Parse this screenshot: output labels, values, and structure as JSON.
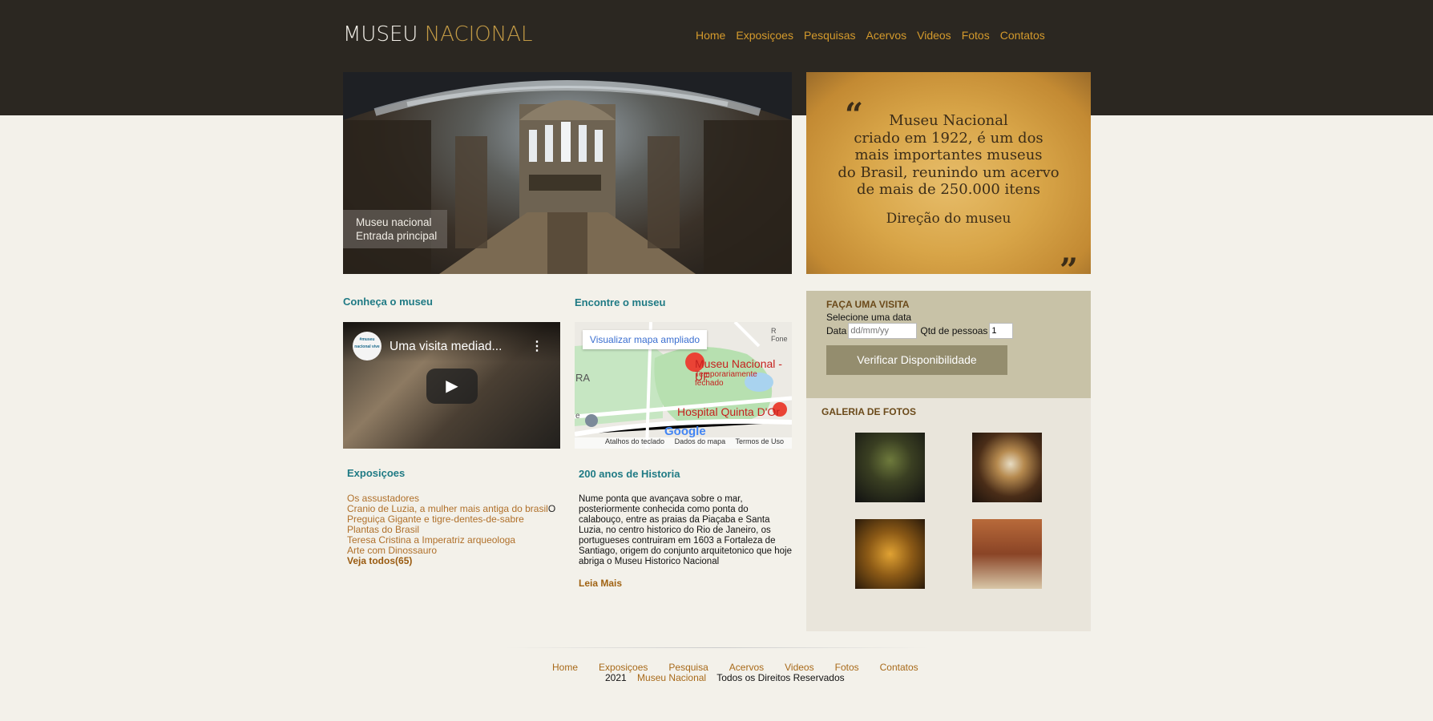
{
  "header": {
    "logo_main": "MUSEU",
    "logo_accent": "NACIONAL",
    "nav": [
      "Home",
      "Exposiçoes",
      "Pesquisas",
      "Acervos",
      "Videos",
      "Fotos",
      "Contatos"
    ],
    "colors": {
      "band": "#2b2721",
      "nav": "#d49a2c",
      "logo_accent": "#c29a45"
    }
  },
  "hero": {
    "caption_line1": "Museu nacional",
    "caption_line2": "Entrada principal"
  },
  "quote": {
    "line1": "Museu Nacional",
    "line2": "criado em 1922, é um dos",
    "line3": "mais importantes museus",
    "line4": "do Brasil, reunindo um acervo",
    "line5": "de mais de 250.000 itens",
    "signature": "Direção do museu",
    "open_mark": "“",
    "close_mark": "”"
  },
  "know": {
    "title": "Conheça o museu",
    "video_channel": "#museu nacional vive",
    "video_title": "Uma visita mediad...",
    "video_menu": "⋮",
    "play_icon": "▶"
  },
  "find": {
    "title": "Encontre o museu",
    "map_button": "Visualizar mapa ampliado",
    "place_name": "Museu Nacional - UF",
    "place_status": "Temporariamente fechado",
    "hospital": "Hospital Quinta D'Or",
    "google": "Google",
    "map_footer": [
      "Atalhos do teclado",
      "Dados do mapa",
      "Termos de Uso"
    ],
    "map_edge_labels": {
      "top_right": "R Fone",
      "left": "RA",
      "left_lower": "e"
    }
  },
  "expositions": {
    "title": "Exposiçoes",
    "items": [
      "Os assustadores",
      "Cranio de Luzia, a mulher mais antiga do brasil",
      "Preguiça Gigante e tigre-dentes-de-sabre",
      "Plantas do Brasil",
      "Teresa Cristina a Imperatriz arqueologa",
      "Arte com Dinossauro"
    ],
    "item2_suffix": "O",
    "see_all": "Veja todos(65)"
  },
  "history": {
    "title": "200 anos de Historia",
    "text": "Nume ponta que avançava sobre o mar, posteriormente conhecida como ponta do calabouço, entre as praias da Piaçaba e Santa Luzia, no centro historico do Rio de Janeiro, os portugueses contruiram em 1603 a Fortaleza de Santiago, origem do conjunto arquitetonico que hoje abriga o Museu Historico Nacional",
    "read_more": "Leia Mais"
  },
  "visit": {
    "title": "FAÇA UMA VISITA",
    "subtitle": "Selecione uma data",
    "date_label": "Data",
    "date_placeholder": "dd/mm/yy",
    "people_label": "Qtd de pessoas",
    "people_value": "1",
    "button": "Verificar Disponibilidade"
  },
  "gallery": {
    "title": "GALERIA DE FOTOS",
    "photos": [
      "exhibit-hall-photo",
      "dress-display-photo",
      "showcase-photo",
      "exhibit-room-photo"
    ]
  },
  "footer": {
    "nav": [
      "Home",
      "Exposiçoes",
      "Pesquisa",
      "Acervos",
      "Videos",
      "Fotos",
      "Contatos"
    ],
    "year": "2021",
    "brand": "Museu Nacional",
    "rights": "Todos os Direitos Reservados"
  }
}
